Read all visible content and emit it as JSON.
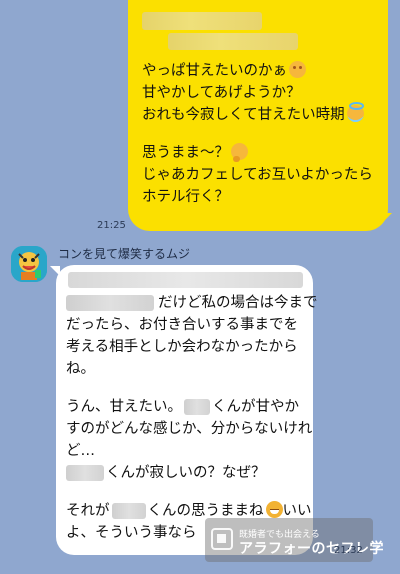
{
  "colors": {
    "background": "#8fa7cf",
    "outgoing_bubble": "#fbe000",
    "incoming_bubble": "#ffffff"
  },
  "bubble_out": {
    "lines": [
      "やっぱ甘えたいのかぁ",
      "甘やかしてあげようか？",
      "おれも今寂しくて甘えたい時期",
      "思うまま〜？",
      "じゃあカフェしてお互いよかったら",
      "ホテル行く？"
    ],
    "time": "21:25"
  },
  "incoming": {
    "sender": "コンを見て爆笑するムジ",
    "time": "21:32",
    "lines": [
      "だけど私の場合は今まで",
      "だったら、お付き合いする事までを",
      "考える相手としか会わなかったから",
      "ね。",
      "うん、甘えたい。",
      "くんが甘やか",
      "すのがどんな感じか、分からないけれ",
      "ど…",
      "くんが寂しいの？なぜ？",
      "それが",
      "くんの思うままね",
      "いい",
      "よ、そういう事なら"
    ]
  },
  "watermark": {
    "top_text": "既婚者でも出会える",
    "main_text": "アラフォーのセフレ学"
  }
}
